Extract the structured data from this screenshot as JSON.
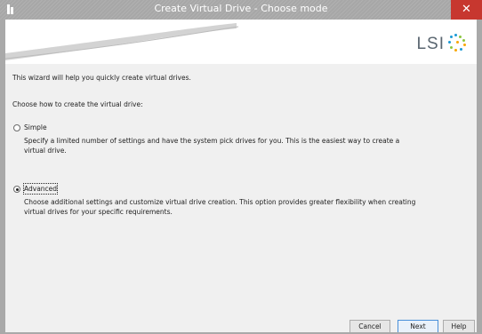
{
  "window": {
    "title": "Create Virtual Drive - Choose mode",
    "close_label": "✕"
  },
  "banner": {
    "logo_text": "LSI"
  },
  "content": {
    "intro": "This wizard will help you quickly create virtual drives.",
    "prompt": "Choose how to create the virtual drive:",
    "options": [
      {
        "label": "Simple",
        "selected": false,
        "description_line1": "Specify a limited number of settings and have the system pick drives for you. This is the easiest way to create a",
        "description_line2": "virtual drive."
      },
      {
        "label": "Advanced",
        "selected": true,
        "description_line1": "Choose additional settings and customize virtual drive creation. This option provides greater flexibility when creating",
        "description_line2": "virtual drives for your specific requirements."
      }
    ]
  },
  "buttons": {
    "cancel": "Cancel",
    "next": "Next",
    "help": "Help"
  },
  "colors": {
    "close": "#c7372f",
    "titlebar": "#a7a7a7",
    "background": "#f0f0f0"
  }
}
